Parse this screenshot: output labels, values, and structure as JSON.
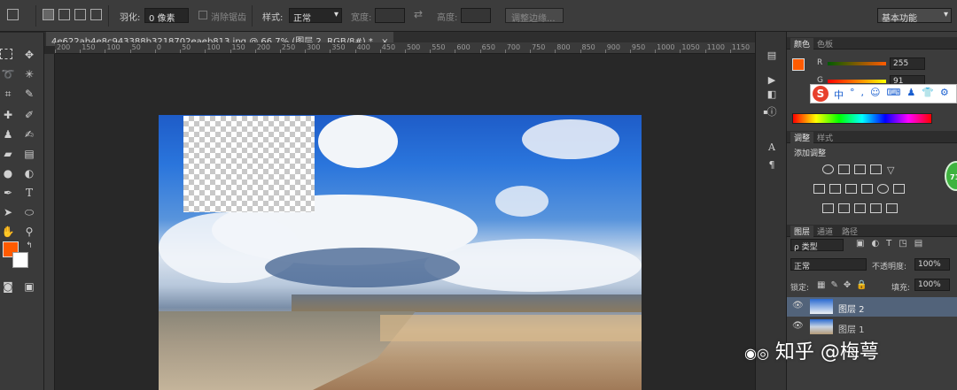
{
  "options_bar": {
    "feather_label": "羽化:",
    "feather_value": "0 像素",
    "antialias_label": "消除锯齿",
    "style_label": "样式:",
    "style_value": "正常",
    "width_label": "宽度:",
    "height_label": "高度:",
    "refine_edge_button": "调整边缘...",
    "workspace_value": "基本功能"
  },
  "document": {
    "tab_title": "4e622ab4e8c943388b3218702eaeb813.jpg @ 66.7% (图层 2, RGB/8#) *",
    "close": "×"
  },
  "ruler": {
    "h_labels": [
      "200",
      "150",
      "100",
      "50",
      "0",
      "50",
      "100",
      "150",
      "200",
      "250",
      "300",
      "350",
      "400",
      "450",
      "500",
      "550",
      "600",
      "650",
      "700",
      "750",
      "800",
      "850",
      "900",
      "950",
      "1000",
      "1050",
      "1100",
      "1150"
    ]
  },
  "color_panel": {
    "tabs": [
      "颜色",
      "色板"
    ],
    "r_label": "R",
    "r_value": "255",
    "g_label": "G",
    "g_value": "91",
    "fg_color": "#ff5b00"
  },
  "adjust_panel": {
    "tabs": [
      "调整",
      "样式"
    ],
    "add_label": "添加调整"
  },
  "layers_panel": {
    "tabs": [
      "图层",
      "通道",
      "路径"
    ],
    "kind_label": "ρ 类型",
    "blend_mode": "正常",
    "opacity_label": "不透明度:",
    "opacity_value": "100%",
    "lock_label": "锁定:",
    "fill_label": "填充:",
    "fill_value": "100%",
    "layers": [
      {
        "name": "图层 2",
        "selected": true
      },
      {
        "name": "图层 1",
        "selected": false
      }
    ]
  },
  "ime_bar": {
    "logo": "S",
    "lang": "中"
  },
  "badge": {
    "value": "71"
  },
  "watermark": {
    "text": "知乎 @梅萼"
  }
}
